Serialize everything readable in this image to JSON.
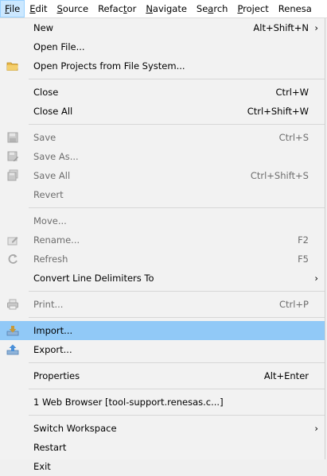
{
  "menubar": {
    "items": [
      {
        "pre": "",
        "mn": "F",
        "post": "ile"
      },
      {
        "pre": "",
        "mn": "E",
        "post": "dit"
      },
      {
        "pre": "",
        "mn": "S",
        "post": "ource"
      },
      {
        "pre": "Refac",
        "mn": "t",
        "post": "or"
      },
      {
        "pre": "",
        "mn": "N",
        "post": "avigate"
      },
      {
        "pre": "Se",
        "mn": "a",
        "post": "rch"
      },
      {
        "pre": "",
        "mn": "P",
        "post": "roject"
      },
      {
        "pre": "Renesa",
        "mn": "",
        "post": ""
      }
    ]
  },
  "menu": {
    "new": {
      "label": "New",
      "accel": "Alt+Shift+N",
      "arrow": "›"
    },
    "open_file": {
      "label": "Open File..."
    },
    "open_projects": {
      "label": "Open Projects from File System..."
    },
    "close": {
      "label": "Close",
      "accel": "Ctrl+W"
    },
    "close_all": {
      "label": "Close All",
      "accel": "Ctrl+Shift+W"
    },
    "save": {
      "label": "Save",
      "accel": "Ctrl+S"
    },
    "save_as": {
      "label": "Save As..."
    },
    "save_all": {
      "label": "Save All",
      "accel": "Ctrl+Shift+S"
    },
    "revert": {
      "label": "Revert"
    },
    "move": {
      "label": "Move..."
    },
    "rename": {
      "label": "Rename...",
      "accel": "F2"
    },
    "refresh": {
      "label": "Refresh",
      "accel": "F5"
    },
    "convert": {
      "label": "Convert Line Delimiters To",
      "arrow": "›"
    },
    "print": {
      "label": "Print...",
      "accel": "Ctrl+P"
    },
    "import": {
      "label": "Import..."
    },
    "export": {
      "label": "Export..."
    },
    "properties": {
      "label": "Properties",
      "accel": "Alt+Enter"
    },
    "recent": {
      "label": "1 Web Browser  [tool-support.renesas.c...]"
    },
    "switch_ws": {
      "label": "Switch Workspace",
      "arrow": "›"
    },
    "restart": {
      "label": "Restart"
    },
    "exit": {
      "label": "Exit"
    }
  },
  "colors": {
    "highlight": "#91c9f7",
    "disabled_text": "#6d6d6d",
    "menu_bg": "#f2f2f2"
  }
}
